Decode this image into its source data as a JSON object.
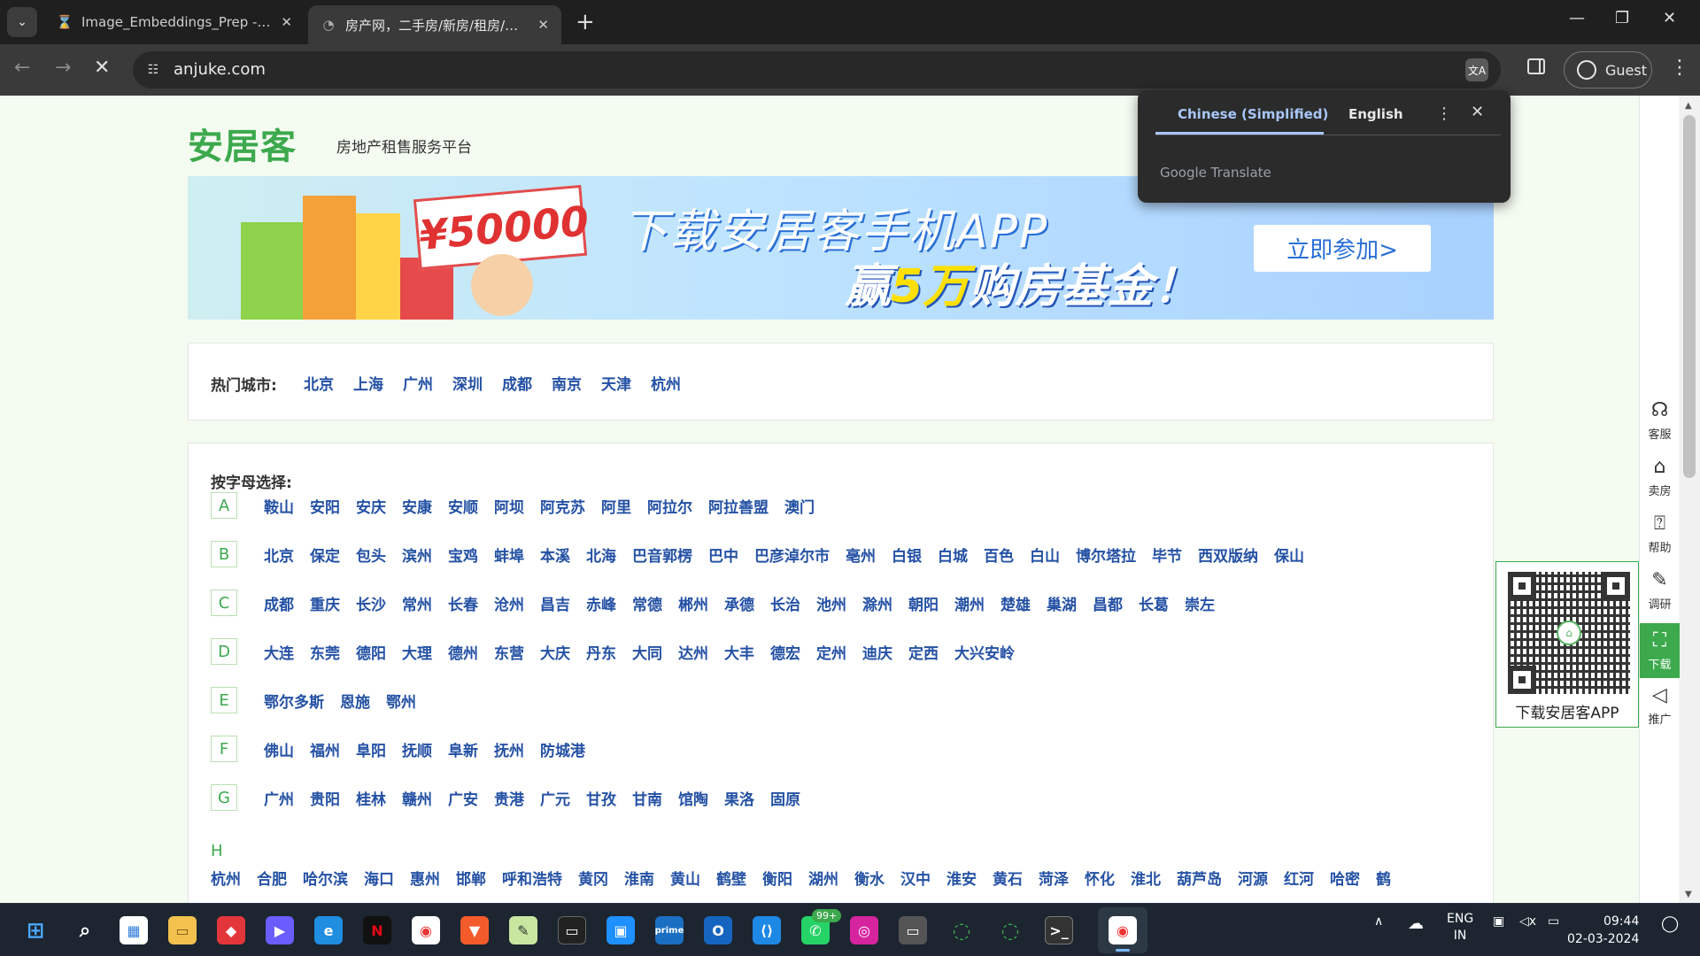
{
  "browser": {
    "tabs": [
      {
        "title": "Image_Embeddings_Prep - Jupyter",
        "favicon": "hourglass-icon"
      },
      {
        "title": "房产网，二手房/新房/租房/写字楼",
        "favicon": "anjuke-icon"
      }
    ],
    "url": "anjuke.com",
    "profile_label": "Guest"
  },
  "translate_popup": {
    "source_lang": "Chinese (Simplified)",
    "target_lang": "English",
    "footer": "Google Translate"
  },
  "page": {
    "logo": "安居客",
    "slogan": "房地产租售服务平台",
    "banner": {
      "amount": "¥50000",
      "headline": "下载安居客手机APP",
      "sub_pre": "赢",
      "sub_hl": "5万",
      "sub_post": "购房基金！",
      "cta": "立即参加>"
    },
    "hot_label": "热门城市:",
    "hot_cities": [
      "北京",
      "上海",
      "广州",
      "深圳",
      "成都",
      "南京",
      "天津",
      "杭州"
    ],
    "alpha_label": "按字母选择:",
    "alpha_rows": [
      {
        "letter": "A",
        "cities": [
          "鞍山",
          "安阳",
          "安庆",
          "安康",
          "安顺",
          "阿坝",
          "阿克苏",
          "阿里",
          "阿拉尔",
          "阿拉善盟",
          "澳门"
        ]
      },
      {
        "letter": "B",
        "cities": [
          "北京",
          "保定",
          "包头",
          "滨州",
          "宝鸡",
          "蚌埠",
          "本溪",
          "北海",
          "巴音郭楞",
          "巴中",
          "巴彦淖尔市",
          "亳州",
          "白银",
          "白城",
          "百色",
          "白山",
          "博尔塔拉",
          "毕节",
          "西双版纳",
          "保山"
        ]
      },
      {
        "letter": "C",
        "cities": [
          "成都",
          "重庆",
          "长沙",
          "常州",
          "长春",
          "沧州",
          "昌吉",
          "赤峰",
          "常德",
          "郴州",
          "承德",
          "长治",
          "池州",
          "滁州",
          "朝阳",
          "潮州",
          "楚雄",
          "巢湖",
          "昌都",
          "长葛",
          "崇左"
        ]
      },
      {
        "letter": "D",
        "cities": [
          "大连",
          "东莞",
          "德阳",
          "大理",
          "德州",
          "东营",
          "大庆",
          "丹东",
          "大同",
          "达州",
          "大丰",
          "德宏",
          "定州",
          "迪庆",
          "定西",
          "大兴安岭"
        ]
      },
      {
        "letter": "E",
        "cities": [
          "鄂尔多斯",
          "恩施",
          "鄂州"
        ]
      },
      {
        "letter": "F",
        "cities": [
          "佛山",
          "福州",
          "阜阳",
          "抚顺",
          "阜新",
          "抚州",
          "防城港"
        ]
      },
      {
        "letter": "G",
        "cities": [
          "广州",
          "贵阳",
          "桂林",
          "赣州",
          "广安",
          "贵港",
          "广元",
          "甘孜",
          "甘南",
          "馆陶",
          "果洛",
          "固原"
        ]
      }
    ],
    "row_h": {
      "letter": "H",
      "cities": [
        "杭州",
        "合肥",
        "哈尔滨",
        "海口",
        "惠州",
        "邯郸",
        "呼和浩特",
        "黄冈",
        "淮南",
        "黄山",
        "鹤壁",
        "衡阳",
        "湖州",
        "衡水",
        "汉中",
        "淮安",
        "黄石",
        "菏泽",
        "怀化",
        "淮北",
        "葫芦岛",
        "河源",
        "红河",
        "哈密",
        "鹤"
      ]
    },
    "qr_caption": "下载安居客APP",
    "side_tools": [
      {
        "icon": "headset-icon",
        "label": "客服"
      },
      {
        "icon": "house-icon",
        "label": "卖房"
      },
      {
        "icon": "question-icon",
        "label": "帮助"
      },
      {
        "icon": "edit-icon",
        "label": "调研"
      },
      {
        "icon": "scan-icon",
        "label": "下载"
      },
      {
        "icon": "speaker-icon",
        "label": "推广"
      }
    ]
  },
  "taskbar": {
    "whatsapp_badge": "99+",
    "lang_line1": "ENG",
    "lang_line2": "IN",
    "time": "09:44",
    "date": "02-03-2024"
  },
  "colors": {
    "brand_green": "#3ca94d",
    "link_blue": "#2451a4",
    "translate_accent": "#a8c7fa"
  }
}
